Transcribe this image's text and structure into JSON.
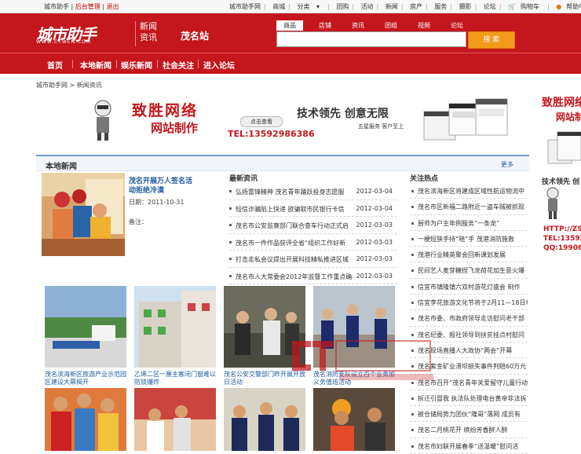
{
  "topbar": {
    "left": [
      "城市助手",
      "后台管理",
      "退出"
    ],
    "right": [
      "城市助手网",
      "商城",
      "分类",
      "团购",
      "活动",
      "新闻",
      "房产",
      "服务",
      "摄影",
      "论坛",
      "购物车",
      "帮助中心"
    ]
  },
  "header": {
    "logo_text": "城市助手",
    "logo_url": "WWW.CTWEN.COM",
    "section": "新闻资讯",
    "station": "茂名站",
    "search_tabs": [
      "商品",
      "店铺",
      "资讯",
      "团组",
      "视频",
      "论坛"
    ],
    "search_button": "搜 索"
  },
  "nav": [
    "首页",
    "本地新闻",
    "娱乐新闻",
    "社会关注",
    "进入论坛"
  ],
  "breadcrumb": "城市助手网 > 新闻资讯",
  "banner": {
    "line1": "致胜网络",
    "line2": "网站制作",
    "button": "点击查看",
    "tel": "TEL:13592986386",
    "slogan": "技术领先 创意无限",
    "slogan2": "五星服务 客户至上"
  },
  "side_ad": {
    "line1": "致胜网络",
    "line2": "网站制",
    "line3": "技术领先 创",
    "line4a": "HTTP://ZS.CTW",
    "line4b": "TEL:135929",
    "line4c": "QQ:19906"
  },
  "main": {
    "title": "本地新闻",
    "more": "更多",
    "feature": {
      "title": "茂名开展万人签名活动拒绝冷漠",
      "date": "日期：2011-10-31",
      "note": "备注："
    },
    "latest": {
      "title": "最新资讯",
      "items": [
        {
          "text": "弘扬雷锋精神 茂名青年踊跃投身志愿服",
          "date": "2012-03-04"
        },
        {
          "text": "短信诈骗陷上快递 欲骗取市民银行卡信",
          "date": "2012-03-04"
        },
        {
          "text": "茂名市公安监察部门联合查车行动正式启",
          "date": "2012-03-03"
        },
        {
          "text": "茂名市一件作品获评全省“组织工作好新",
          "date": "2012-03-03"
        },
        {
          "text": "打击走私会议提出开展科技精私推进区域",
          "date": "2012-03-03"
        },
        {
          "text": "茂名市人大常委会2012年监督工作重点确",
          "date": "2012-03-03"
        }
      ]
    },
    "hot": {
      "title": "关注热点",
      "items": [
        "茂名滨海新区将建成区域性航运物流中",
        "茂名市区新福二路附近一盗车贼被抓现",
        "厨师为户主年例服务“一条龙”",
        "一梗短狭手持“晓”手 茂港消防施救",
        "茂港行业精英聚会回新课划发展",
        "民间艺人麦芽糖捏飞龙荷花加生意火爆",
        "信宜市镇隆镇六双村游花灯盛会 制作",
        "信宜李花旅游文化节将于2月11—18日举",
        "茂名市委、市政府领导走访慰问老干部",
        "茂名纪委、报社领导到扶贫挂点村慰问",
        "茂名现场直播人大政协“两会”开幕",
        "茂名紫金矿业溃坝损失事件判赔60万元",
        "茂名市召开“茂名青年关爱留守儿童行动",
        "拆迁引冒我 执法队处理电台黄帝非法拆",
        "被仓储局势力团伙“隆哥”落网 成员有",
        "茂名二月桃花开 缤纷芳香醉人醉",
        "茂名市妇联开展春季“送温暖”慰问活"
      ]
    },
    "thumbs": [
      "茂名滨海新区旅游产业示范园区建设大幕揭开",
      "乙烯二区一厘主客闭门窗难以防锁爆炸",
      "茂名公安交警部门昨开展开放日活动",
      "茂名消防支队设立百个业务加义务值班活动",
      "",
      "",
      "",
      ""
    ]
  }
}
